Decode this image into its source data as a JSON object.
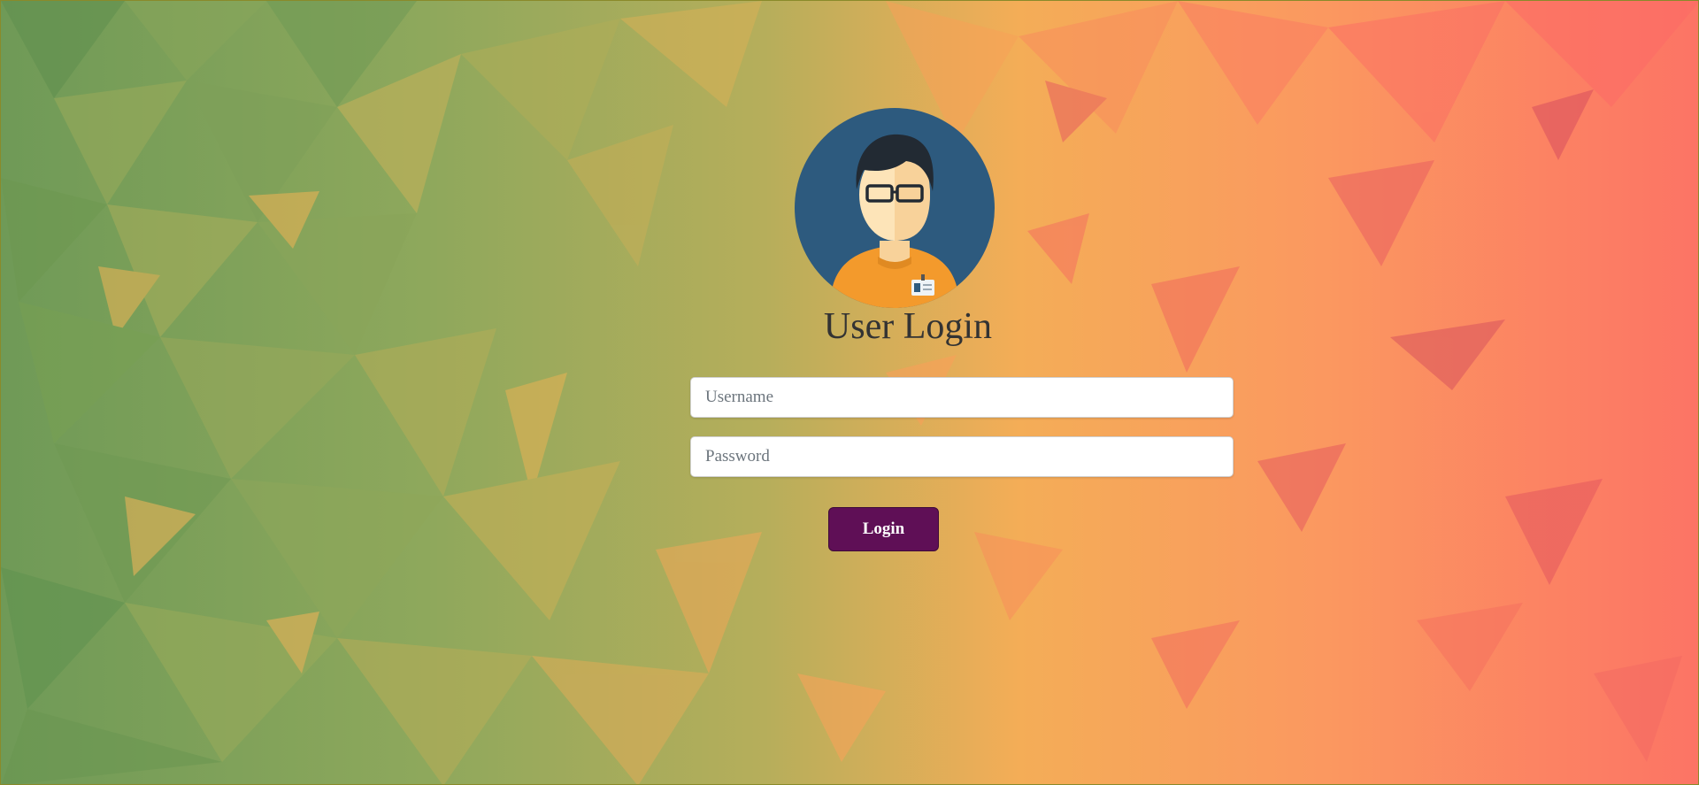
{
  "login": {
    "title": "User Login",
    "username_placeholder": "Username",
    "password_placeholder": "Password",
    "button_label": "Login"
  },
  "colors": {
    "button_bg": "#5f0f56",
    "title_text": "#333333",
    "avatar_circle": "#2d5a7e",
    "shirt": "#f39a2c",
    "background_left": "#6f9a57",
    "background_right": "#fc7465"
  },
  "icons": {
    "avatar": "user-avatar-icon",
    "badge": "id-badge-icon"
  }
}
